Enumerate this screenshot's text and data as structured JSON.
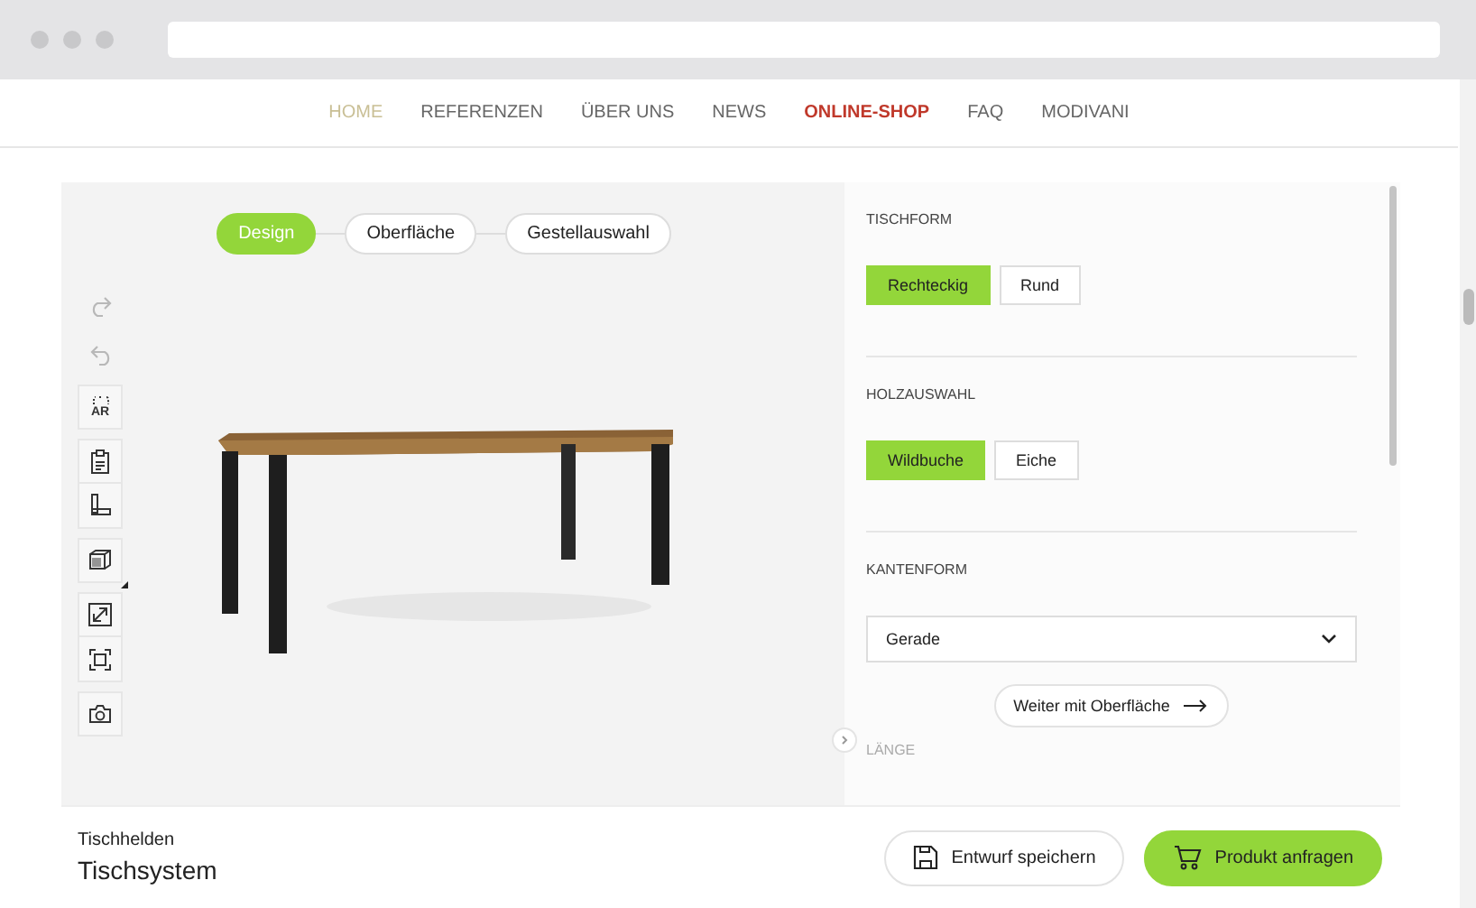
{
  "nav": [
    {
      "label": "HOME",
      "selected": true,
      "emphasized": false
    },
    {
      "label": "REFERENZEN",
      "selected": false,
      "emphasized": false
    },
    {
      "label": "ÜBER UNS",
      "selected": false,
      "emphasized": false
    },
    {
      "label": "NEWS",
      "selected": false,
      "emphasized": false
    },
    {
      "label": "ONLINE-SHOP",
      "selected": false,
      "emphasized": true
    },
    {
      "label": "FAQ",
      "selected": false,
      "emphasized": false
    },
    {
      "label": "MODIVANI",
      "selected": false,
      "emphasized": false
    }
  ],
  "steps": [
    {
      "label": "Design",
      "selected": true
    },
    {
      "label": "Oberfläche",
      "selected": false
    },
    {
      "label": "Gestellauswahl",
      "selected": false
    }
  ],
  "tool_groups": [
    {
      "tools": [
        {
          "kind": "redo",
          "disabled": true
        }
      ]
    },
    {
      "tools": [
        {
          "kind": "undo",
          "disabled": true
        }
      ]
    },
    {
      "tools": [
        {
          "kind": "ar",
          "label": "AR",
          "disabled": false
        }
      ]
    },
    {
      "tools": [
        {
          "kind": "clipboard",
          "disabled": false
        },
        {
          "kind": "measure",
          "disabled": false
        }
      ]
    },
    {
      "tools": [
        {
          "kind": "cube",
          "disabled": false
        }
      ]
    },
    {
      "tools": [
        {
          "kind": "expand",
          "disabled": false
        },
        {
          "kind": "frame",
          "disabled": false
        }
      ]
    },
    {
      "tools": [
        {
          "kind": "camera",
          "disabled": false
        }
      ]
    }
  ],
  "sections": [
    {
      "kind": "options",
      "title": "TISCHFORM",
      "options": [
        {
          "label": "Rechteckig",
          "selected": true
        },
        {
          "label": "Rund",
          "selected": false
        }
      ]
    },
    {
      "kind": "options",
      "title": "HOLZAUSWAHL",
      "options": [
        {
          "label": "Wildbuche",
          "selected": true
        },
        {
          "label": "Eiche",
          "selected": false
        }
      ]
    },
    {
      "kind": "select",
      "title": "KANTENFORM",
      "value": "Gerade"
    },
    {
      "kind": "button",
      "label": "Weiter mit Oberfläche"
    },
    {
      "kind": "heading",
      "title": "LÄNGE"
    }
  ],
  "footer": {
    "brand": "Tischhelden",
    "product": "Tischsystem",
    "actions": [
      {
        "kind": "save",
        "label": "Entwurf speichern"
      },
      {
        "kind": "request",
        "label": "Produkt anfragen"
      }
    ]
  }
}
